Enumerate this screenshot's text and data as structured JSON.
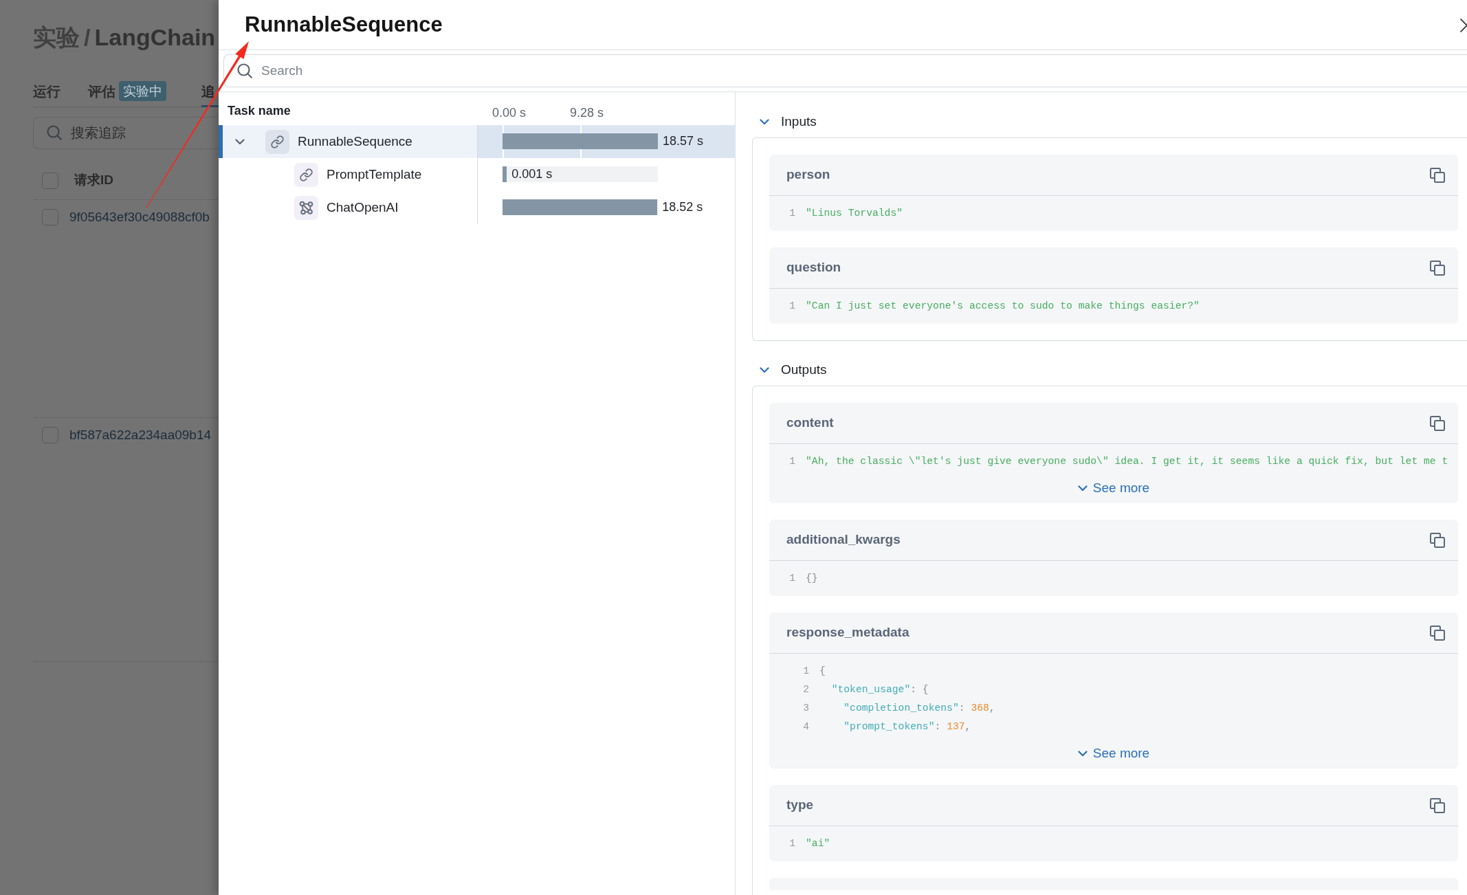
{
  "background_page": {
    "breadcrumb": {
      "items": [
        "实验",
        "LangChain"
      ],
      "separator": "/"
    },
    "tabs": [
      {
        "label": "运行",
        "selected": false
      },
      {
        "label": "评估",
        "selected": false,
        "badge": "实验中"
      },
      {
        "label": "追",
        "selected": true
      }
    ],
    "search": {
      "placeholder": "搜索追踪"
    },
    "table": {
      "columns": [
        "请求ID"
      ],
      "header_checked": false,
      "rows": [
        {
          "id": "9f05643ef30c49088cf0b",
          "checked": false
        },
        {
          "id": "bf587a622a234aa09b14",
          "checked": false
        }
      ]
    }
  },
  "drawer": {
    "title": "RunnableSequence",
    "search": {
      "placeholder": "Search"
    },
    "task_table": {
      "columns": [
        "Task name"
      ],
      "ticks": [
        "0.00 s",
        "9.28 s"
      ],
      "tasks": [
        {
          "name": "RunnableSequence",
          "kind": "chain",
          "selected": true,
          "expanded": true,
          "duration": "18.57 s",
          "level": 1,
          "children": [
            {
              "name": "PromptTemplate",
              "kind": "chain",
              "selected": false,
              "duration": "0.001 s",
              "level": 0.028
            },
            {
              "name": "ChatOpenAI",
              "kind": "llm",
              "selected": false,
              "duration": "18.52 s",
              "level": 0.997
            }
          ]
        }
      ]
    },
    "sections": [
      {
        "title": "Inputs",
        "expanded": true,
        "truncated": false,
        "fields": [
          {
            "name": "person",
            "lines": [
              {
                "number": "1",
                "tokens": [
                  {
                    "kind": "string",
                    "text": "\"Linus Torvalds\""
                  }
                ]
              }
            ]
          },
          {
            "name": "question",
            "lines": [
              {
                "number": "1",
                "tokens": [
                  {
                    "kind": "string",
                    "text": "\"Can I just set everyone's access to sudo to make things easier?\""
                  }
                ]
              }
            ]
          }
        ]
      },
      {
        "title": "Outputs",
        "expanded": true,
        "truncated": true,
        "fields": [
          {
            "name": "content",
            "lines": [
              {
                "number": "1",
                "tokens": [
                  {
                    "kind": "string",
                    "text": "\"Ah, the classic \\\"let's just give everyone sudo\\\" idea. I get it, it seems like a quick fix, but let me t"
                  }
                ]
              }
            ],
            "see_more": "See more"
          },
          {
            "name": "additional_kwargs",
            "lines": [
              {
                "number": "1",
                "tokens": [
                  {
                    "kind": "punct",
                    "text": "{}"
                  }
                ]
              }
            ]
          },
          {
            "name": "response_metadata",
            "lines": [
              {
                "number": "1",
                "tokens": [
                  {
                    "kind": "punct",
                    "text": "{"
                  }
                ]
              },
              {
                "number": "2",
                "tokens": [
                  {
                    "kind": "key",
                    "text": "  \"token_usage\""
                  },
                  {
                    "kind": "punct",
                    "text": ": {"
                  }
                ]
              },
              {
                "number": "3",
                "tokens": [
                  {
                    "kind": "key",
                    "text": "    \"completion_tokens\""
                  },
                  {
                    "kind": "punct",
                    "text": ": "
                  },
                  {
                    "kind": "number",
                    "text": "368"
                  },
                  {
                    "kind": "punct",
                    "text": ","
                  }
                ]
              },
              {
                "number": "4",
                "tokens": [
                  {
                    "kind": "key",
                    "text": "    \"prompt_tokens\""
                  },
                  {
                    "kind": "punct",
                    "text": ": "
                  },
                  {
                    "kind": "number",
                    "text": "137"
                  },
                  {
                    "kind": "punct",
                    "text": ","
                  }
                ]
              }
            ],
            "see_more": "See more"
          },
          {
            "name": "type",
            "lines": [
              {
                "number": "1",
                "tokens": [
                  {
                    "kind": "string",
                    "text": "\"ai\""
                  }
                ]
              }
            ]
          }
        ]
      }
    ]
  }
}
